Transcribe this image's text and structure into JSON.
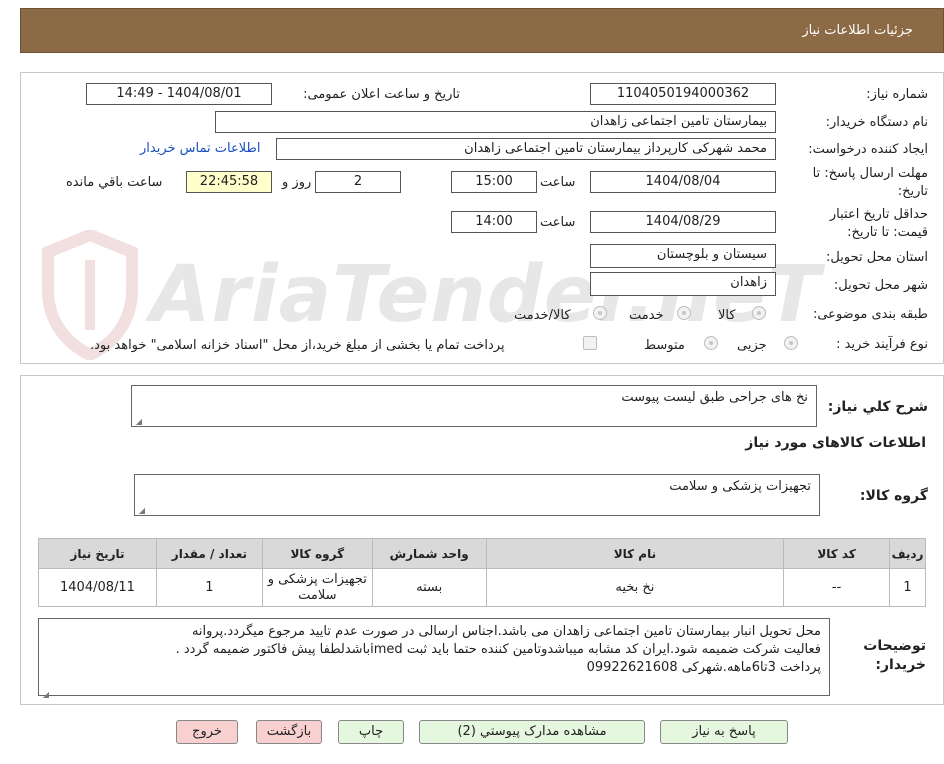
{
  "header": {
    "title": "جزئیات اطلاعات نیاز"
  },
  "fields": {
    "need_number_label": "شماره نیاز:",
    "need_number": "1104050194000362",
    "announce_label": "تاریخ و ساعت اعلان عمومی:",
    "announce_value": "1404/08/01 - 14:49",
    "buyer_org_label": "نام دستگاه خریدار:",
    "buyer_org": "بیمارستان تامین اجتماعی زاهدان",
    "requester_label": "ایجاد کننده درخواست:",
    "requester": "محمد شهرکی کارپرداز بیمارستان تامین اجتماعی زاهدان",
    "contact_link": "اطلاعات تماس خریدار",
    "deadline_label_1": "مهلت ارسال پاسخ: تا",
    "deadline_label_2": "تاریخ:",
    "deadline_date": "1404/08/04",
    "time_label": "ساعت",
    "deadline_time": "15:00",
    "days_value": "2",
    "days_label": "روز و",
    "remaining_time": "22:45:58",
    "remaining_label": "ساعت باقي مانده",
    "validity_label_1": "حداقل تاریخ اعتبار",
    "validity_label_2": "قیمت: تا تاریخ:",
    "validity_date": "1404/08/29",
    "validity_time": "14:00",
    "province_label": "استان محل تحویل:",
    "province": "سیستان و بلوچستان",
    "city_label": "شهر محل تحویل:",
    "city": "زاهدان",
    "category_label": "طبقه بندی موضوعی:",
    "category_options": [
      "کالا",
      "خدمت",
      "کالا/خدمت"
    ],
    "process_label": "نوع فرآیند خرید :",
    "process_options": [
      "جزیی",
      "متوسط"
    ],
    "payment_note": "پرداخت تمام یا بخشی از مبلغ خرید،از محل \"اسناد خزانه اسلامی\" خواهد بود."
  },
  "summary": {
    "description_label": "شرح کلي نیاز:",
    "description": "نخ های جراحی طبق لیست پیوست",
    "items_title": "اطلاعات کالاهای مورد نیاز",
    "group_label": "گروه کالا:",
    "group_value": "تجهیزات پزشکی و سلامت"
  },
  "table": {
    "headers": [
      "ردیف",
      "کد کالا",
      "نام کالا",
      "واحد شمارش",
      "گروه کالا",
      "تعداد / مقدار",
      "تاریخ نیاز"
    ],
    "rows": [
      [
        "1",
        "--",
        "نخ بخیه",
        "بسته",
        "تجهیزات پزشکی و سلامت",
        "1",
        "1404/08/11"
      ]
    ]
  },
  "buyer_notes": {
    "label_1": "توضیحات",
    "label_2": "خریدار:",
    "lines": [
      "محل تحویل انبار بیمارستان تامین اجتماعی زاهدان می باشد.اجناس ارسالی در صورت عدم تایید مرجوع میگردد.پروانه",
      "فعالیت شرکت ضمیمه شود.ایران کد مشابه میباشدوتامین کننده حتما باید ثبت imedباشدلطفا پیش فاکتور ضمیمه گردد .",
      "پرداخت 3تا6ماهه.شهرکی 09922621608"
    ]
  },
  "buttons": {
    "reply": "پاسخ به نیاز",
    "attachments": "مشاهده مدارک پیوستي (2)",
    "print": "چاپ",
    "back": "بازگشت",
    "exit": "خروج"
  },
  "watermark": "AriaTender.neT"
}
